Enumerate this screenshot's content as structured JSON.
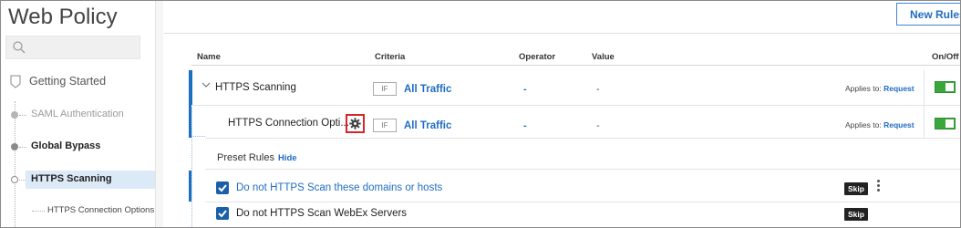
{
  "sidebar": {
    "title": "Web Policy",
    "search": {
      "placeholder": ""
    },
    "items": [
      {
        "label": "Getting Started"
      },
      {
        "label": "SAML Authentication"
      },
      {
        "label": "Global Bypass"
      },
      {
        "label": "HTTPS Scanning"
      },
      {
        "label": "HTTPS Connection Options"
      }
    ]
  },
  "toolbar": {
    "new_rules_label": "New Rules"
  },
  "table": {
    "columns": {
      "name": "Name",
      "criteria": "Criteria",
      "operator": "Operator",
      "value": "Value",
      "onoff": "On/Off"
    },
    "rows": [
      {
        "name": "HTTPS Scanning",
        "if": "IF",
        "criteria": "All Traffic",
        "operator": "-",
        "value": "-",
        "applies_prefix": "Applies to:",
        "applies_value": "Request",
        "enabled": true
      },
      {
        "name": "HTTPS Connection Opti...",
        "if": "IF",
        "criteria": "All Traffic",
        "operator": "-",
        "value": "-",
        "applies_prefix": "Applies to:",
        "applies_value": "Request",
        "enabled": true
      }
    ]
  },
  "preset": {
    "label": "Preset Rules",
    "hide_label": "Hide",
    "rules": [
      {
        "label": "Do not HTTPS Scan these domains or hosts",
        "badge": "Skip",
        "checked": true
      },
      {
        "label": "Do not HTTPS Scan WebEx Servers",
        "badge": "Skip",
        "checked": true
      }
    ]
  },
  "colors": {
    "accent": "#1a6fc2",
    "toggle_on": "#3aa73a",
    "highlight_border": "#d6262a"
  }
}
